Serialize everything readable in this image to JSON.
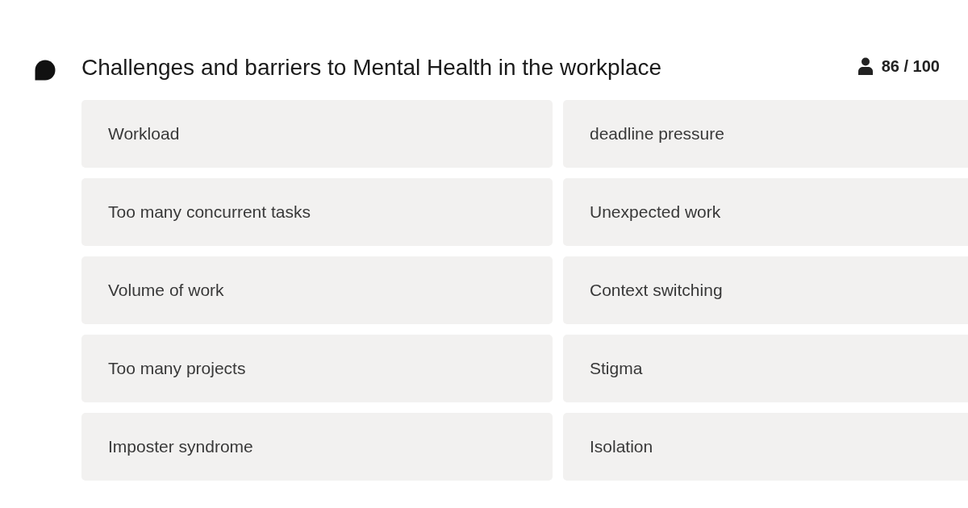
{
  "question": {
    "title": "Challenges and barriers to Mental Health in the workplace",
    "responses": "86 / 100"
  },
  "answers": [
    {
      "text": "Workload"
    },
    {
      "text": "deadline pressure"
    },
    {
      "text": "Too many concurrent tasks"
    },
    {
      "text": "Unexpected work"
    },
    {
      "text": "Volume of work"
    },
    {
      "text": "Context switching"
    },
    {
      "text": "Too many projects"
    },
    {
      "text": "Stigma"
    },
    {
      "text": "Imposter syndrome"
    },
    {
      "text": "Isolation"
    }
  ]
}
